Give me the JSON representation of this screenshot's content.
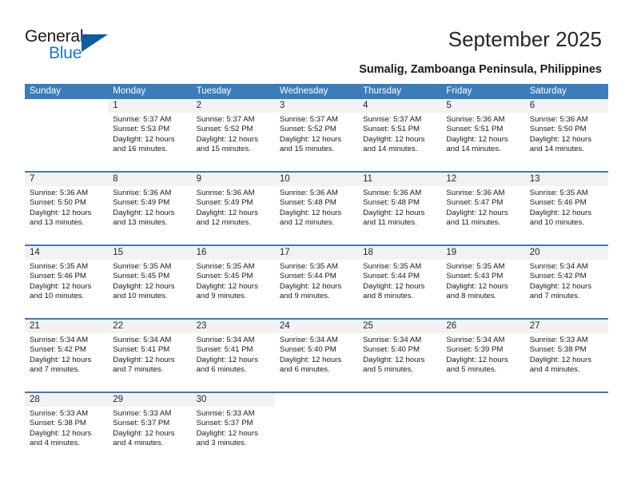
{
  "logo": {
    "primary_text": "General",
    "secondary_text": "Blue",
    "triangle_color": "#115ba0",
    "blue_text_color": "#1878c8"
  },
  "header": {
    "title": "September 2025",
    "subtitle": "Sumalig, Zamboanga Peninsula, Philippines"
  },
  "calendar": {
    "header_color": "#3b7cba",
    "daynum_band_color": "#f2f2f2",
    "weekdays": [
      "Sunday",
      "Monday",
      "Tuesday",
      "Wednesday",
      "Thursday",
      "Friday",
      "Saturday"
    ],
    "weeks": [
      [
        {
          "day": "",
          "sunrise": "",
          "sunset": "",
          "daylight1": "",
          "daylight2": ""
        },
        {
          "day": "1",
          "sunrise": "Sunrise: 5:37 AM",
          "sunset": "Sunset: 5:53 PM",
          "daylight1": "Daylight: 12 hours",
          "daylight2": "and 16 minutes."
        },
        {
          "day": "2",
          "sunrise": "Sunrise: 5:37 AM",
          "sunset": "Sunset: 5:52 PM",
          "daylight1": "Daylight: 12 hours",
          "daylight2": "and 15 minutes."
        },
        {
          "day": "3",
          "sunrise": "Sunrise: 5:37 AM",
          "sunset": "Sunset: 5:52 PM",
          "daylight1": "Daylight: 12 hours",
          "daylight2": "and 15 minutes."
        },
        {
          "day": "4",
          "sunrise": "Sunrise: 5:37 AM",
          "sunset": "Sunset: 5:51 PM",
          "daylight1": "Daylight: 12 hours",
          "daylight2": "and 14 minutes."
        },
        {
          "day": "5",
          "sunrise": "Sunrise: 5:36 AM",
          "sunset": "Sunset: 5:51 PM",
          "daylight1": "Daylight: 12 hours",
          "daylight2": "and 14 minutes."
        },
        {
          "day": "6",
          "sunrise": "Sunrise: 5:36 AM",
          "sunset": "Sunset: 5:50 PM",
          "daylight1": "Daylight: 12 hours",
          "daylight2": "and 14 minutes."
        }
      ],
      [
        {
          "day": "7",
          "sunrise": "Sunrise: 5:36 AM",
          "sunset": "Sunset: 5:50 PM",
          "daylight1": "Daylight: 12 hours",
          "daylight2": "and 13 minutes."
        },
        {
          "day": "8",
          "sunrise": "Sunrise: 5:36 AM",
          "sunset": "Sunset: 5:49 PM",
          "daylight1": "Daylight: 12 hours",
          "daylight2": "and 13 minutes."
        },
        {
          "day": "9",
          "sunrise": "Sunrise: 5:36 AM",
          "sunset": "Sunset: 5:49 PM",
          "daylight1": "Daylight: 12 hours",
          "daylight2": "and 12 minutes."
        },
        {
          "day": "10",
          "sunrise": "Sunrise: 5:36 AM",
          "sunset": "Sunset: 5:48 PM",
          "daylight1": "Daylight: 12 hours",
          "daylight2": "and 12 minutes."
        },
        {
          "day": "11",
          "sunrise": "Sunrise: 5:36 AM",
          "sunset": "Sunset: 5:48 PM",
          "daylight1": "Daylight: 12 hours",
          "daylight2": "and 11 minutes."
        },
        {
          "day": "12",
          "sunrise": "Sunrise: 5:36 AM",
          "sunset": "Sunset: 5:47 PM",
          "daylight1": "Daylight: 12 hours",
          "daylight2": "and 11 minutes."
        },
        {
          "day": "13",
          "sunrise": "Sunrise: 5:35 AM",
          "sunset": "Sunset: 5:46 PM",
          "daylight1": "Daylight: 12 hours",
          "daylight2": "and 10 minutes."
        }
      ],
      [
        {
          "day": "14",
          "sunrise": "Sunrise: 5:35 AM",
          "sunset": "Sunset: 5:46 PM",
          "daylight1": "Daylight: 12 hours",
          "daylight2": "and 10 minutes."
        },
        {
          "day": "15",
          "sunrise": "Sunrise: 5:35 AM",
          "sunset": "Sunset: 5:45 PM",
          "daylight1": "Daylight: 12 hours",
          "daylight2": "and 10 minutes."
        },
        {
          "day": "16",
          "sunrise": "Sunrise: 5:35 AM",
          "sunset": "Sunset: 5:45 PM",
          "daylight1": "Daylight: 12 hours",
          "daylight2": "and 9 minutes."
        },
        {
          "day": "17",
          "sunrise": "Sunrise: 5:35 AM",
          "sunset": "Sunset: 5:44 PM",
          "daylight1": "Daylight: 12 hours",
          "daylight2": "and 9 minutes."
        },
        {
          "day": "18",
          "sunrise": "Sunrise: 5:35 AM",
          "sunset": "Sunset: 5:44 PM",
          "daylight1": "Daylight: 12 hours",
          "daylight2": "and 8 minutes."
        },
        {
          "day": "19",
          "sunrise": "Sunrise: 5:35 AM",
          "sunset": "Sunset: 5:43 PM",
          "daylight1": "Daylight: 12 hours",
          "daylight2": "and 8 minutes."
        },
        {
          "day": "20",
          "sunrise": "Sunrise: 5:34 AM",
          "sunset": "Sunset: 5:42 PM",
          "daylight1": "Daylight: 12 hours",
          "daylight2": "and 7 minutes."
        }
      ],
      [
        {
          "day": "21",
          "sunrise": "Sunrise: 5:34 AM",
          "sunset": "Sunset: 5:42 PM",
          "daylight1": "Daylight: 12 hours",
          "daylight2": "and 7 minutes."
        },
        {
          "day": "22",
          "sunrise": "Sunrise: 5:34 AM",
          "sunset": "Sunset: 5:41 PM",
          "daylight1": "Daylight: 12 hours",
          "daylight2": "and 7 minutes."
        },
        {
          "day": "23",
          "sunrise": "Sunrise: 5:34 AM",
          "sunset": "Sunset: 5:41 PM",
          "daylight1": "Daylight: 12 hours",
          "daylight2": "and 6 minutes."
        },
        {
          "day": "24",
          "sunrise": "Sunrise: 5:34 AM",
          "sunset": "Sunset: 5:40 PM",
          "daylight1": "Daylight: 12 hours",
          "daylight2": "and 6 minutes."
        },
        {
          "day": "25",
          "sunrise": "Sunrise: 5:34 AM",
          "sunset": "Sunset: 5:40 PM",
          "daylight1": "Daylight: 12 hours",
          "daylight2": "and 5 minutes."
        },
        {
          "day": "26",
          "sunrise": "Sunrise: 5:34 AM",
          "sunset": "Sunset: 5:39 PM",
          "daylight1": "Daylight: 12 hours",
          "daylight2": "and 5 minutes."
        },
        {
          "day": "27",
          "sunrise": "Sunrise: 5:33 AM",
          "sunset": "Sunset: 5:38 PM",
          "daylight1": "Daylight: 12 hours",
          "daylight2": "and 4 minutes."
        }
      ],
      [
        {
          "day": "28",
          "sunrise": "Sunrise: 5:33 AM",
          "sunset": "Sunset: 5:38 PM",
          "daylight1": "Daylight: 12 hours",
          "daylight2": "and 4 minutes."
        },
        {
          "day": "29",
          "sunrise": "Sunrise: 5:33 AM",
          "sunset": "Sunset: 5:37 PM",
          "daylight1": "Daylight: 12 hours",
          "daylight2": "and 4 minutes."
        },
        {
          "day": "30",
          "sunrise": "Sunrise: 5:33 AM",
          "sunset": "Sunset: 5:37 PM",
          "daylight1": "Daylight: 12 hours",
          "daylight2": "and 3 minutes."
        },
        {
          "day": "",
          "sunrise": "",
          "sunset": "",
          "daylight1": "",
          "daylight2": ""
        },
        {
          "day": "",
          "sunrise": "",
          "sunset": "",
          "daylight1": "",
          "daylight2": ""
        },
        {
          "day": "",
          "sunrise": "",
          "sunset": "",
          "daylight1": "",
          "daylight2": ""
        },
        {
          "day": "",
          "sunrise": "",
          "sunset": "",
          "daylight1": "",
          "daylight2": ""
        }
      ]
    ]
  }
}
